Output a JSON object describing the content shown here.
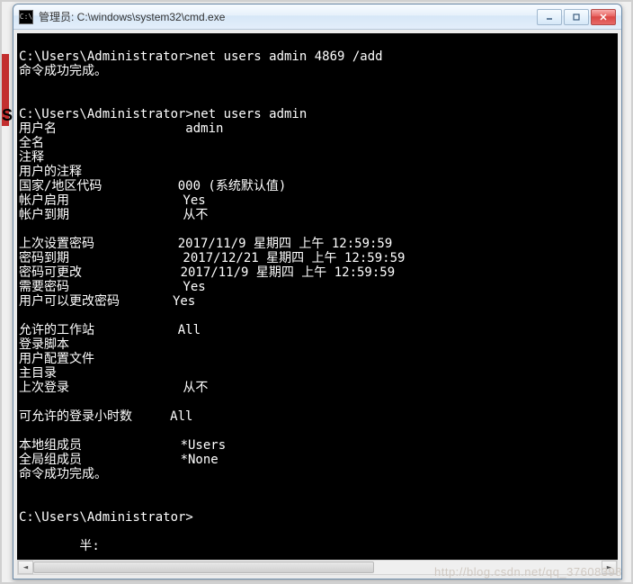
{
  "window": {
    "title": "管理员: C:\\windows\\system32\\cmd.exe",
    "icon_label": "C:\\"
  },
  "behind": {
    "strip_color": "#c32f2f",
    "letter": "S"
  },
  "console": {
    "lines": [
      "",
      "C:\\Users\\Administrator>net users admin 4869 /add",
      "命令成功完成。",
      "",
      "",
      "C:\\Users\\Administrator>net users admin",
      "用户名                 admin",
      "全名",
      "注释",
      "用户的注释",
      "国家/地区代码          000 (系统默认值)",
      "帐户启用               Yes",
      "帐户到期               从不",
      "",
      "上次设置密码           2017/11/9 星期四 上午 12:59:59",
      "密码到期               2017/12/21 星期四 上午 12:59:59",
      "密码可更改             2017/11/9 星期四 上午 12:59:59",
      "需要密码               Yes",
      "用户可以更改密码       Yes",
      "",
      "允许的工作站           All",
      "登录脚本",
      "用户配置文件",
      "主目录",
      "上次登录               从不",
      "",
      "可允许的登录小时数     All",
      "",
      "本地组成员             *Users",
      "全局组成员             *None",
      "命令成功完成。",
      "",
      "",
      "C:\\Users\\Administrator>",
      "",
      "        半:"
    ]
  },
  "watermark": "http://blog.csdn.net/qq_37608398"
}
